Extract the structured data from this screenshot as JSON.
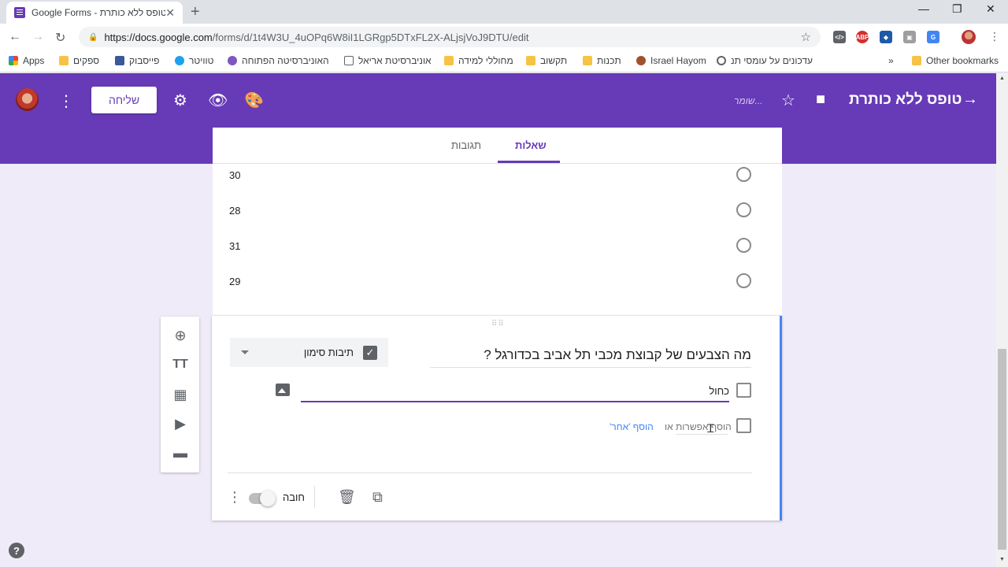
{
  "browser": {
    "tab_title": "Google Forms - טופס ללא כותרת",
    "tab_close": "✕",
    "new_tab": "+",
    "url_host": "https://docs.google.com",
    "url_path": "/forms/d/1t4W3U_4uOPq6W8iI1LGRgp5DTxFL2X-ALjsjVoJ9DTU/edit",
    "window_controls": [
      "—",
      "❐",
      "✕"
    ],
    "extensions": [
      {
        "label": "</>",
        "color": "#5f6368"
      },
      {
        "label": "ABP",
        "color": "#d32f2f"
      },
      {
        "label": "◆",
        "color": "#1e5aa8"
      },
      {
        "label": "▣",
        "color": "#9e9e9e"
      },
      {
        "label": "G",
        "color": "#4285f4"
      }
    ]
  },
  "bookmarks": {
    "apps": "Apps",
    "items": [
      "ספקים",
      "פייסבוק",
      "טוויטר",
      "האוניברסיטה הפתוחה",
      "אוניברסיטת אריאל",
      "מחוללי למידה",
      "תקשוב",
      "תכנות",
      "Israel Hayom",
      "עדכונים על עומסי תנ"
    ],
    "more": "»",
    "other": "Other bookmarks"
  },
  "header": {
    "send_label": "שליחה",
    "saving_text": "שומר...",
    "form_title": "טופס ללא כותרת",
    "accent": "#673ab7"
  },
  "tabs": {
    "questions": "שאלות",
    "responses": "תגובות"
  },
  "prev_options": [
    "30",
    "28",
    "31",
    "29"
  ],
  "question": {
    "title": "מה הצבעים של קבוצת מכבי תל אביב בכדורגל ?",
    "type_label": "תיבות סימון",
    "option_value": "כחול",
    "add_option": "הוסף אפשרות",
    "or": "או",
    "add_other": "הוסף 'אחר'",
    "required_label": "חובה"
  }
}
